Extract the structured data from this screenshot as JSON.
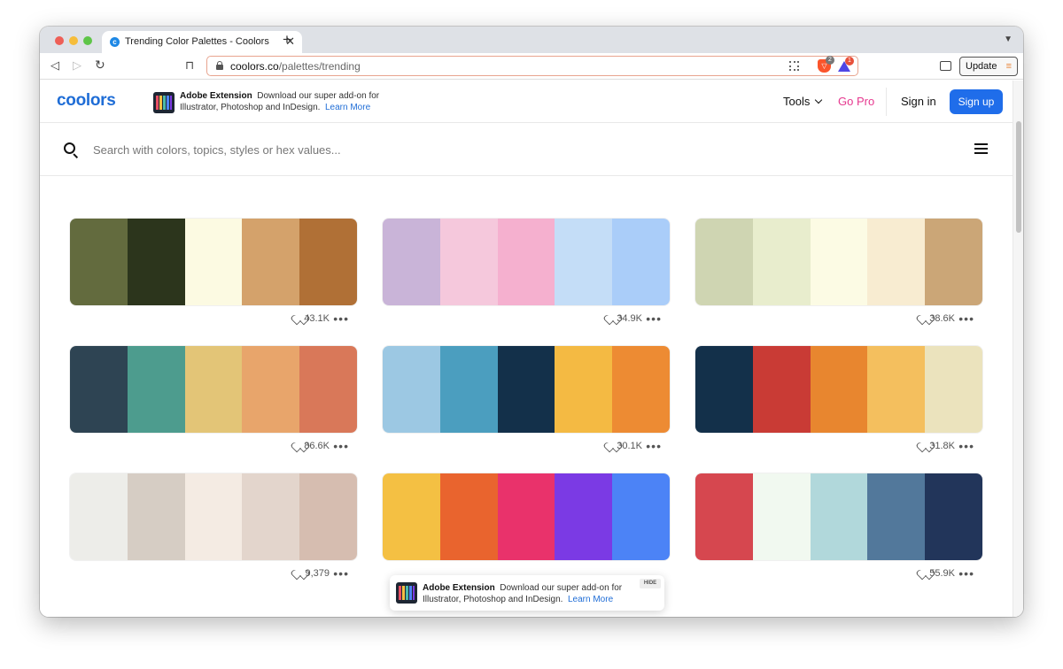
{
  "browser": {
    "tab_title": "Trending Color Palettes - Coolors",
    "url_host": "coolors.co",
    "url_path": "/palettes/trending",
    "shield_count": "2",
    "alert_count": "1",
    "update_label": "Update"
  },
  "header": {
    "logo": "coolors",
    "promo": {
      "title": "Adobe Extension",
      "text": "Download our super add-on for Illustrator, Photoshop and InDesign.",
      "link": "Learn More"
    },
    "nav": {
      "tools": "Tools",
      "go_pro": "Go Pro",
      "sign_in": "Sign in",
      "sign_up": "Sign up"
    }
  },
  "search": {
    "placeholder": "Search with colors, topics, styles or hex values..."
  },
  "palettes": [
    {
      "colors": [
        "#636b3e",
        "#2c351c",
        "#fcfae2",
        "#d4a26b",
        "#b07036"
      ],
      "likes": "43.1K"
    },
    {
      "colors": [
        "#c9b4d8",
        "#f5c8dc",
        "#f5b0cf",
        "#c4ddf7",
        "#aacdf9"
      ],
      "likes": "34.9K"
    },
    {
      "colors": [
        "#cfd5b2",
        "#e8edcd",
        "#fcfbe4",
        "#f8ecd1",
        "#cba677"
      ],
      "likes": "38.6K"
    },
    {
      "colors": [
        "#2e4453",
        "#4d9c8e",
        "#e3c577",
        "#e8a56b",
        "#d97859"
      ],
      "likes": "86.6K"
    },
    {
      "colors": [
        "#9cc8e3",
        "#4b9ebf",
        "#13304a",
        "#f4ba43",
        "#ed8b33"
      ],
      "likes": "30.1K"
    },
    {
      "colors": [
        "#13304a",
        "#c93b35",
        "#e8862f",
        "#f4bf5e",
        "#ebe3bd"
      ],
      "likes": "31.8K"
    },
    {
      "colors": [
        "#edede9",
        "#d6cdc4",
        "#f4ebe3",
        "#e3d5cc",
        "#d6bdb0"
      ],
      "likes": "9,379"
    },
    {
      "colors": [
        "#f4c043",
        "#e9642e",
        "#e9326b",
        "#7b3ae4",
        "#4c83f6"
      ],
      "likes": ""
    },
    {
      "colors": [
        "#d6474f",
        "#f1f9f0",
        "#b1d8db",
        "#52789b",
        "#22355a"
      ],
      "likes": "55.9K"
    }
  ],
  "floating_promo": {
    "title": "Adobe Extension",
    "text": "Download our super add-on for Illustrator, Photoshop and InDesign.",
    "link": "Learn More",
    "hide": "HIDE"
  }
}
